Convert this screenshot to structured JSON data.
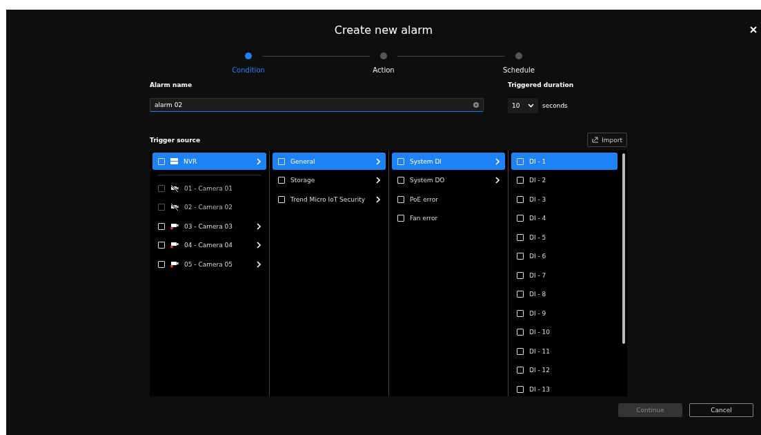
{
  "dialog": {
    "title": "Create new alarm"
  },
  "steps": [
    {
      "label": "Condition",
      "selected": true
    },
    {
      "label": "Action",
      "selected": false
    },
    {
      "label": "Schedule",
      "selected": false
    }
  ],
  "alarm_name": {
    "label": "Alarm name",
    "value": "alarm 02"
  },
  "triggered_duration": {
    "label": "Triggered duration",
    "value": "10",
    "unit": "seconds"
  },
  "trigger_source": {
    "label": "Trigger source",
    "import_button": "Import",
    "columns": [
      {
        "divider": true,
        "items": [
          {
            "kind": "nvr",
            "label": "NVR",
            "selected": true,
            "checked": false,
            "disabled": false,
            "has_children": true
          },
          {
            "kind": "offline-camera",
            "label": "01 - Camera 01",
            "selected": false,
            "checked": false,
            "disabled": true,
            "has_children": false
          },
          {
            "kind": "offline-camera",
            "label": "02 - Camera 02",
            "selected": false,
            "checked": false,
            "disabled": true,
            "has_children": false
          },
          {
            "kind": "camera",
            "label": "03 - Camera 03",
            "selected": false,
            "checked": false,
            "disabled": false,
            "has_children": true
          },
          {
            "kind": "camera",
            "label": "04 - Camera 04",
            "selected": false,
            "checked": false,
            "disabled": false,
            "has_children": true
          },
          {
            "kind": "camera",
            "label": "05 - Camera 05",
            "selected": false,
            "checked": false,
            "disabled": false,
            "has_children": true
          }
        ]
      },
      {
        "divider": false,
        "items": [
          {
            "kind": "plain",
            "label": "General",
            "selected": true,
            "checked": false,
            "disabled": false,
            "has_children": true
          },
          {
            "kind": "plain",
            "label": "Storage",
            "selected": false,
            "checked": false,
            "disabled": false,
            "has_children": true
          },
          {
            "kind": "plain",
            "label": "Trend Micro IoT Security",
            "selected": false,
            "checked": false,
            "disabled": false,
            "has_children": true
          }
        ]
      },
      {
        "divider": false,
        "items": [
          {
            "kind": "plain",
            "label": "System DI",
            "selected": true,
            "checked": false,
            "disabled": false,
            "has_children": true
          },
          {
            "kind": "plain",
            "label": "System DO",
            "selected": false,
            "checked": false,
            "disabled": false,
            "has_children": true
          },
          {
            "kind": "plain",
            "label": "PoE error",
            "selected": false,
            "checked": false,
            "disabled": false,
            "has_children": false
          },
          {
            "kind": "plain",
            "label": "Fan error",
            "selected": false,
            "checked": false,
            "disabled": false,
            "has_children": false
          }
        ]
      },
      {
        "divider": false,
        "items": [
          {
            "kind": "plain",
            "label": "DI - 1",
            "selected": true,
            "checked": false,
            "disabled": false,
            "has_children": false
          },
          {
            "kind": "plain",
            "label": "DI - 2",
            "selected": false,
            "checked": false,
            "disabled": false,
            "has_children": false
          },
          {
            "kind": "plain",
            "label": "DI - 3",
            "selected": false,
            "checked": false,
            "disabled": false,
            "has_children": false
          },
          {
            "kind": "plain",
            "label": "DI - 4",
            "selected": false,
            "checked": false,
            "disabled": false,
            "has_children": false
          },
          {
            "kind": "plain",
            "label": "DI - 5",
            "selected": false,
            "checked": false,
            "disabled": false,
            "has_children": false
          },
          {
            "kind": "plain",
            "label": "DI - 6",
            "selected": false,
            "checked": false,
            "disabled": false,
            "has_children": false
          },
          {
            "kind": "plain",
            "label": "DI - 7",
            "selected": false,
            "checked": false,
            "disabled": false,
            "has_children": false
          },
          {
            "kind": "plain",
            "label": "DI - 8",
            "selected": false,
            "checked": false,
            "disabled": false,
            "has_children": false
          },
          {
            "kind": "plain",
            "label": "DI - 9",
            "selected": false,
            "checked": false,
            "disabled": false,
            "has_children": false
          },
          {
            "kind": "plain",
            "label": "DI - 10",
            "selected": false,
            "checked": false,
            "disabled": false,
            "has_children": false
          },
          {
            "kind": "plain",
            "label": "DI - 11",
            "selected": false,
            "checked": false,
            "disabled": false,
            "has_children": false
          },
          {
            "kind": "plain",
            "label": "DI - 12",
            "selected": false,
            "checked": false,
            "disabled": false,
            "has_children": false
          },
          {
            "kind": "plain",
            "label": "DI - 13",
            "selected": false,
            "checked": false,
            "disabled": false,
            "has_children": false
          }
        ]
      }
    ]
  },
  "buttons": [
    {
      "label": "Continue",
      "disabled": true
    },
    {
      "label": "Cancel",
      "disabled": false
    }
  ]
}
